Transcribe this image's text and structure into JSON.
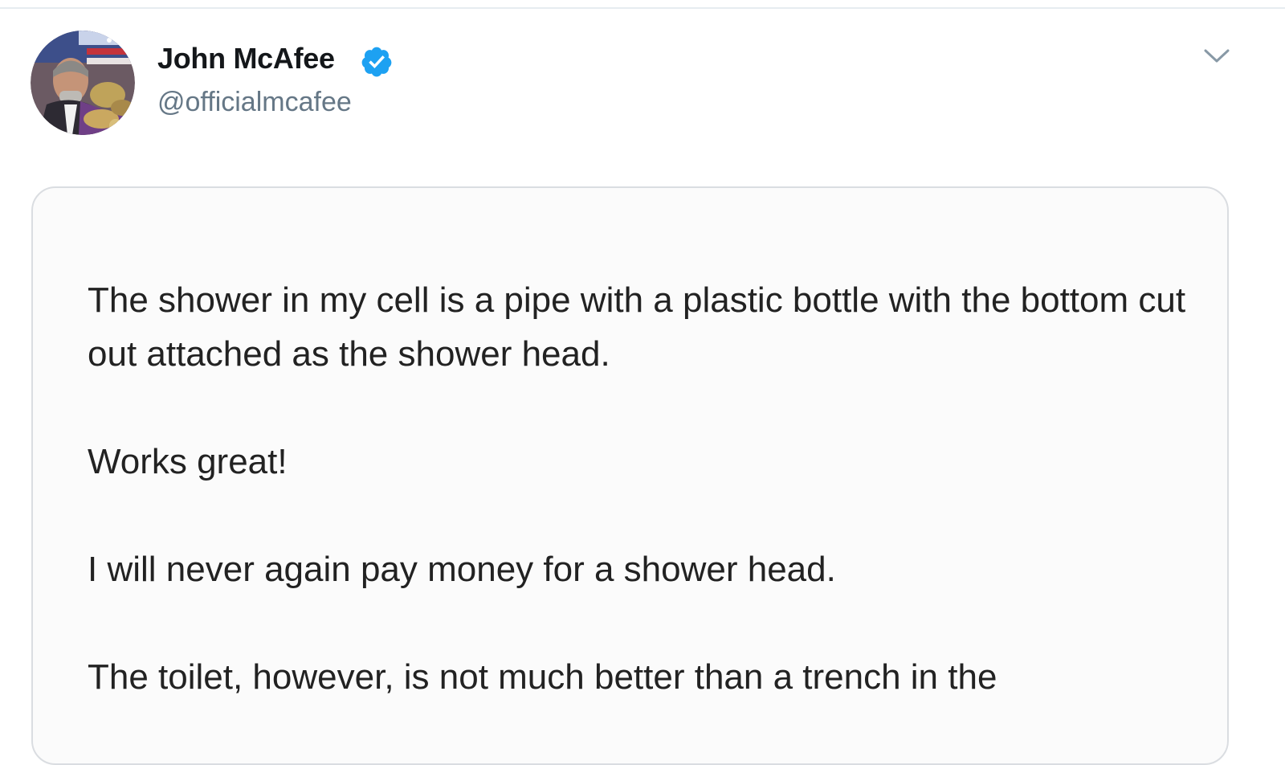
{
  "tweet": {
    "author_name": "John McAfee",
    "author_handle": "@officialmcafee",
    "verified": true,
    "icons": {
      "verified": "verified-badge-icon",
      "more": "chevron-down-icon",
      "avatar": "profile-photo"
    },
    "colors": {
      "verified_blue": "#1da1f2",
      "handle_gray": "#657786"
    },
    "card": {
      "paragraphs": [
        "The shower in my cell is a pipe with a plastic bottle with the bottom cut out attached as the shower head.",
        "Works great!",
        "I will never again pay money for a shower head.",
        "The toilet, however, is not much better than a trench in the"
      ]
    }
  }
}
